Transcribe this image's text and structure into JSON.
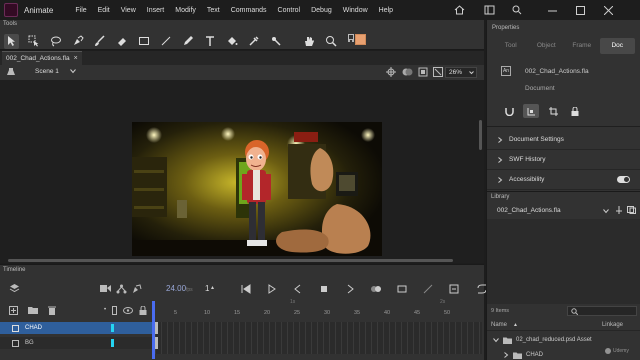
{
  "app": {
    "name": "Animate",
    "menu": [
      "File",
      "Edit",
      "View",
      "Insert",
      "Modify",
      "Text",
      "Commands",
      "Control",
      "Debug",
      "Window",
      "Help"
    ],
    "icons": [
      "app-logo-icon",
      "home-icon",
      "workspace-layout-icon",
      "search-help-icon",
      "minimize-icon",
      "maximize-icon",
      "close-icon"
    ]
  },
  "tools_panel": {
    "title": "Tools",
    "tools": [
      "selection-tool-icon",
      "subselection-tool-icon",
      "lasso-tool-icon",
      "pen-tool-icon",
      "brush-tool-icon",
      "eraser-tool-icon",
      "rectangle-tool-icon",
      "line-tool-icon",
      "pencil-tool-icon",
      "text-tool-icon",
      "paint-bucket-tool-icon",
      "eyedropper-tool-icon",
      "bone-tool-icon",
      "hand-tool-icon",
      "zoom-tool-icon",
      "more-tools-icon"
    ],
    "fill_color": "#e8a070"
  },
  "document_tab": {
    "name": "002_Chad_Actions.fla"
  },
  "stage_bar": {
    "scene": "Scene 1",
    "zoom": "26%"
  },
  "timeline": {
    "title": "Timeline",
    "fps": "24.00",
    "fps_unit": "fps",
    "frame": "1",
    "ruler_small": [
      "1s",
      "2s"
    ],
    "ruler_numbers": [
      "5",
      "10",
      "15",
      "20",
      "25",
      "30",
      "35",
      "40",
      "45",
      "50"
    ],
    "layers": [
      {
        "name": "CHAD",
        "selected": true,
        "color": "#25d4f2"
      },
      {
        "name": "BG",
        "selected": false,
        "color": "#25d4f2"
      }
    ]
  },
  "properties": {
    "title": "Properties",
    "tabs": [
      "Tool",
      "Object",
      "Frame",
      "Doc"
    ],
    "active_tab": "Doc",
    "document_name": "002_Chad_Actions.fla",
    "document_label": "Document",
    "sections": [
      "Document Settings",
      "SWF History",
      "Accessibility"
    ]
  },
  "library": {
    "title": "Library",
    "selected_file": "002_Chad_Actions.fla",
    "item_count": "9 Items",
    "columns": [
      "Name",
      "Linkage"
    ],
    "items": [
      {
        "name": "02_chad_reduced.psd Asset",
        "expanded": true,
        "indent": 0
      },
      {
        "name": "CHAD",
        "expanded": false,
        "indent": 1
      }
    ]
  },
  "watermark": "Udemy"
}
